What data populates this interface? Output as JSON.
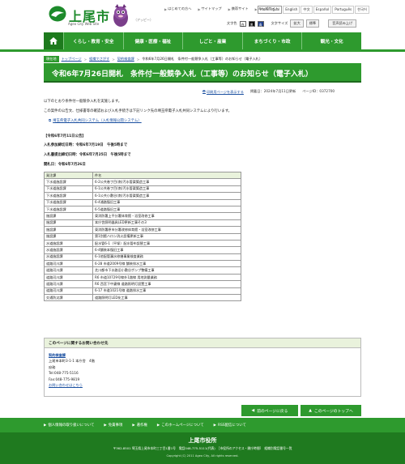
{
  "header": {
    "logo_title": "上尾市",
    "logo_sub": "Ageo City Web Site",
    "mascot_name": "（アッピー）",
    "top_links": [
      {
        "label": "はじめての方へ"
      },
      {
        "label": "サイトマップ"
      },
      {
        "label": "携帯サイト"
      },
      {
        "label": "キッズサイト"
      }
    ],
    "languages": [
      "Multilingual",
      "English",
      "中文",
      "Español",
      "Português",
      "한국어"
    ],
    "color_label": "文字色",
    "color_options": [
      "白",
      "黒",
      "青"
    ],
    "size_label": "文字サイズ",
    "size_options": [
      "拡大",
      "標準"
    ],
    "speech_label": "音声読み上げ"
  },
  "nav": {
    "items": [
      "くらし・教育・安全",
      "健康・医療・福祉",
      "しごと・産業",
      "まちづくり・市政",
      "観光・文化"
    ]
  },
  "breadcrumb": {
    "here": "現在地",
    "items": [
      "トップページ",
      "組織でさがす",
      "契約検査課",
      "令和6年7月26日開札　条件付一般競争入札（工事等）のお知らせ（電子入札）"
    ]
  },
  "page": {
    "title": "令和6年7月26日開札　条件付一般競争入札（工事等）のお知らせ（電子入札）",
    "print_label": "印刷用ページを表示する",
    "updated": "掲載日：2024年7月11日更新",
    "page_id": "ページID：0372700",
    "intro": "以下のとおり条件付一般競争入札を実施します。",
    "note": "この案件の公告文、仕様書等の確認および入札手続きは下記リンク先の埼玉県電子入札共同システムにより行います。",
    "system_link": "埼玉県電子入札共同システム（入札情報公開システム）",
    "announce": "【令和6年7月11日公告】",
    "apply_deadline": "入札参加締切日時：令和6年7月19日　午後5時まで",
    "bid_deadline": "入札書提出締切日時：令和6年7月25日　午後5時まで",
    "open_date": "開札日：令和6年7月26日"
  },
  "table": {
    "headers": [
      "発注課",
      "件名"
    ],
    "rows": [
      [
        "下水道施設課",
        "6-2公共巻丁目(南)汚水管渠築造工事"
      ],
      [
        "下水道施設課",
        "6-1公共巻丁目(南)汚水管渠築造工事"
      ],
      [
        "下水道施設課",
        "6-1公共小敷谷(南)汚水管渠築造工事"
      ],
      [
        "下水道施設課",
        "6-4浦路復旧工事"
      ],
      [
        "下水道施設課",
        "6-5道路復旧工事"
      ],
      [
        "施設課",
        "東消防署上平分署体育館・浴室改修工事"
      ],
      [
        "施設課",
        "本庁舎照明器具LED更新工事その3"
      ],
      [
        "施設課",
        "東消防署原市分署改修体育館・浴室改修工事"
      ],
      [
        "施設課",
        "第1別館ハロン消火設備更新工事"
      ],
      [
        "水道施設課",
        "配水管6-1（平塚）配水管布設替工事"
      ],
      [
        "水道施設課",
        "6-4舗装本復旧工事"
      ],
      [
        "水道施設課",
        "6-1他配管漏水修繕事業検査業務"
      ],
      [
        "道路河川課",
        "6-28 市道2009号線 舗装排水工事"
      ],
      [
        "道路河川課",
        "芝川都市下水路旧小敷谷ポンプ整備工事"
      ],
      [
        "道路河川課",
        "R6 市道10729号線外1路線 用地測量業務"
      ],
      [
        "道路河川課",
        "R6 西宮下中妻線 道路照明灯設置工事"
      ],
      [
        "道路河川課",
        "6-17 市道1021号線 道路排水工事"
      ],
      [
        "交通防災課",
        "道路照明灯LED化工事"
      ]
    ]
  },
  "contact": {
    "heading": "このページに関するお問い合わせ先",
    "dept": "契約検査課",
    "address": "上尾市本町3-1-1 本庁舎　4階",
    "category": "庶務",
    "tel": "Tel:048-775-5116",
    "fax": "Fax:048-775-9819",
    "form_link": "お問い合わせはこちら"
  },
  "buttons": {
    "back": "前のページに戻る",
    "top": "このページのトップへ"
  },
  "footer": {
    "links": [
      "個人情報の取り扱いについて",
      "免責事項",
      "著作権",
      "このホームページについて",
      "RSS配信について"
    ],
    "name": "上尾市役所",
    "address": "〒362-8501 埼玉県上尾市本町三丁目1番1号　電話048-775-5111(代表)　［市役所のアクセス・開庁時間］　組織別電話番号一覧",
    "copyright": "Copyright (C) 2011 Ageo City, All rights reserved."
  },
  "colors": {
    "brand_green": "#2e9a2e",
    "dark_green": "#1f7a1f",
    "table_header": "#e9f2dc",
    "link_blue": "#1a4fa0"
  }
}
